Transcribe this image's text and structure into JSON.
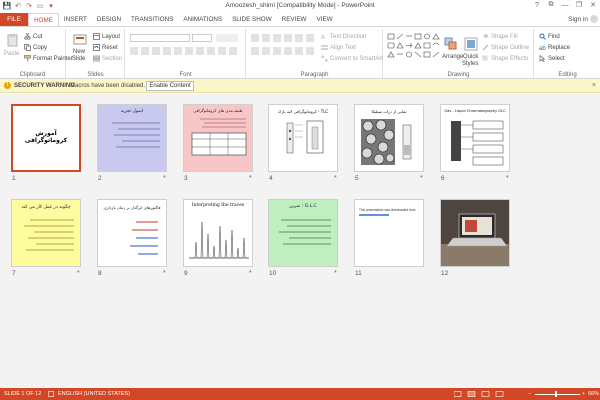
{
  "window": {
    "title": "Amoozesh_shimi [Compatibility Mode] - PowerPoint",
    "minimize": "—",
    "restore": "❐",
    "close": "✕",
    "help": "?",
    "options": "⧉"
  },
  "qat": {
    "save": "💾",
    "undo": "↶",
    "redo": "↷",
    "start": "▭",
    "customize": "▾"
  },
  "tabs": [
    {
      "label": "FILE"
    },
    {
      "label": "HOME"
    },
    {
      "label": "INSERT"
    },
    {
      "label": "DESIGN"
    },
    {
      "label": "TRANSITIONS"
    },
    {
      "label": "ANIMATIONS"
    },
    {
      "label": "SLIDE SHOW"
    },
    {
      "label": "REVIEW"
    },
    {
      "label": "VIEW"
    }
  ],
  "signin": "Sign in",
  "ribbon": {
    "clipboard": {
      "label": "Clipboard",
      "paste": "Paste",
      "cut": "Cut",
      "copy": "Copy",
      "format_painter": "Format Painter"
    },
    "slides": {
      "label": "Slides",
      "new_slide": "New",
      "new_slide2": "Slide",
      "layout": "Layout",
      "reset": "Reset",
      "section": "Section"
    },
    "font": {
      "label": "Font"
    },
    "paragraph": {
      "label": "Paragraph",
      "text_direction": "Text Direction",
      "align_text": "Align Text",
      "smartart": "Convert to SmartArt"
    },
    "drawing": {
      "label": "Drawing",
      "arrange": "Arrange",
      "quick_styles": "Quick",
      "quick_styles2": "Styles",
      "shape_fill": "Shape Fill",
      "shape_outline": "Shape Outline",
      "shape_effects": "Shape Effects"
    },
    "editing": {
      "label": "Editing",
      "find": "Find",
      "replace": "Replace",
      "select": "Select"
    }
  },
  "security": {
    "icon": "!",
    "title": "SECURITY WARNING",
    "message": "Macros have been disabled.",
    "button": "Enable Content",
    "close": "×"
  },
  "slides": [
    {
      "num": "1",
      "star": "",
      "title": "آموزش کروماتوگرافی"
    },
    {
      "num": "2",
      "star": "*",
      "title": "اصول تجزیه"
    },
    {
      "num": "3",
      "star": "*",
      "title": "طبقه بندی های کروماتوگرافی"
    },
    {
      "num": "4",
      "star": "*",
      "title": "کروماتوگرافی لایه نازک - TLC"
    },
    {
      "num": "5",
      "star": "*",
      "title": "نمایی از ذرات سیلیکا"
    },
    {
      "num": "6",
      "star": "*",
      "title": "Gas - Liquid Chromatography GLC"
    },
    {
      "num": "7",
      "star": "*",
      "title": "چگونه در عمل کار می کند"
    },
    {
      "num": "8",
      "star": "*",
      "title": "فاکتورهای اثرگذار بر زمان بازداری"
    },
    {
      "num": "9",
      "star": "*",
      "title": "Interpreting the traces"
    },
    {
      "num": "10",
      "star": "*",
      "title": "تمرین : G.L.C"
    },
    {
      "num": "11",
      "star": "",
      "title": "This presentation was downloaded from"
    },
    {
      "num": "12",
      "star": "",
      "title": ""
    }
  ],
  "status": {
    "slide": "SLIDE 1 OF 12",
    "language": "ENGLISH (UNITED STATES)",
    "zoom": "66%",
    "zoom_minus": "−",
    "zoom_plus": "+"
  }
}
